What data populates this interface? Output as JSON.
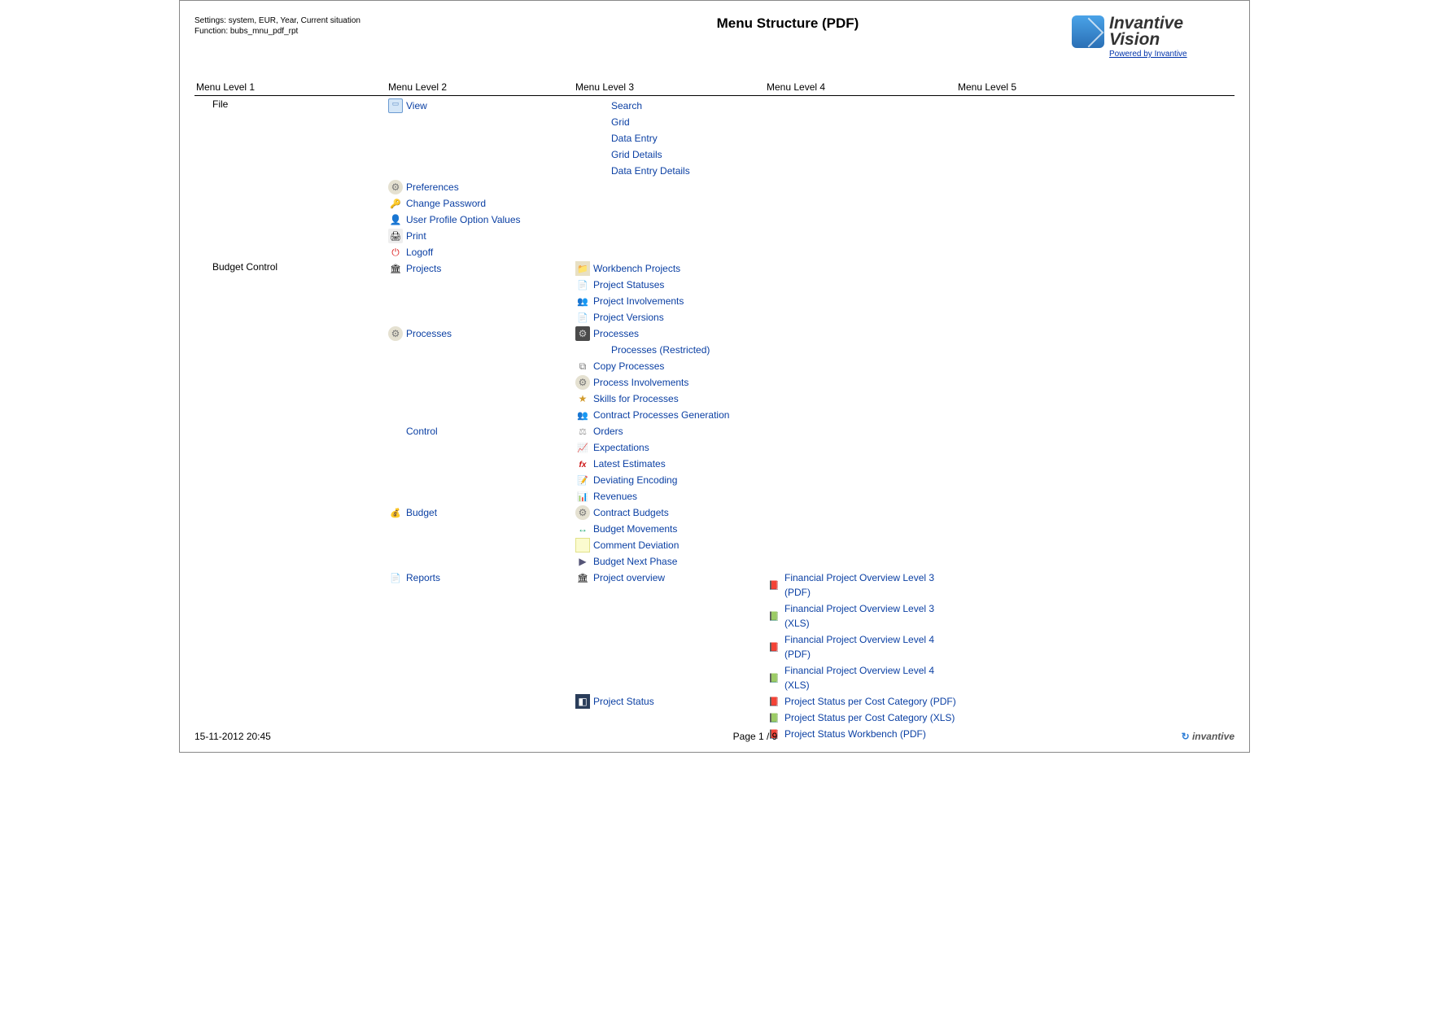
{
  "settings_line": "Settings: system, EUR, Year, Current situation",
  "function_line": "Function: bubs_mnu_pdf_rpt",
  "title": "Menu Structure (PDF)",
  "logo": {
    "line1": "Invantive",
    "line2": "Vision",
    "powered": "Powered by Invantive"
  },
  "columns": [
    "Menu Level 1",
    "Menu Level 2",
    "Menu Level 3",
    "Menu Level 4",
    "Menu Level 5"
  ],
  "tree": [
    {
      "l1": "File",
      "l2": [
        {
          "label": "View",
          "icon": "icon-monitor",
          "l3": [
            {
              "label": "Search"
            },
            {
              "label": "Grid"
            },
            {
              "label": "Data Entry"
            },
            {
              "label": "Grid Details"
            },
            {
              "label": "Data Entry Details"
            }
          ]
        },
        {
          "label": "Preferences",
          "icon": "icon-gear"
        },
        {
          "label": "Change Password",
          "icon": "icon-key"
        },
        {
          "label": "User Profile Option Values",
          "icon": "icon-user"
        },
        {
          "label": "Print",
          "icon": "icon-printer"
        },
        {
          "label": "Logoff",
          "icon": "icon-logoff"
        }
      ]
    },
    {
      "l1": "Budget Control",
      "l2": [
        {
          "label": "Projects",
          "icon": "icon-over",
          "l3": [
            {
              "label": "Workbench Projects",
              "icon": "icon-folder"
            },
            {
              "label": "Project Statuses",
              "icon": "icon-doc"
            },
            {
              "label": "Project Involvements",
              "icon": "icon-people"
            },
            {
              "label": "Project Versions",
              "icon": "icon-doc"
            }
          ]
        },
        {
          "label": "Processes",
          "icon": "icon-gear",
          "l3": [
            {
              "label": "Processes",
              "icon": "icon-cog"
            },
            {
              "label": "Processes (Restricted)"
            },
            {
              "label": "Copy Processes",
              "icon": "icon-copy"
            },
            {
              "label": "Process Involvements",
              "icon": "icon-gear"
            },
            {
              "label": "Skills for Processes",
              "icon": "icon-skill"
            },
            {
              "label": "Contract Processes Generation",
              "icon": "icon-people"
            }
          ]
        },
        {
          "label": "Control",
          "l3": [
            {
              "label": "Orders",
              "icon": "icon-scale"
            },
            {
              "label": "Expectations",
              "icon": "icon-chart"
            },
            {
              "label": "Latest Estimates",
              "icon": "icon-fx"
            },
            {
              "label": "Deviating Encoding",
              "icon": "icon-note"
            },
            {
              "label": "Revenues",
              "icon": "icon-rev"
            }
          ]
        },
        {
          "label": "Budget",
          "icon": "icon-budget",
          "l3": [
            {
              "label": "Contract Budgets",
              "icon": "icon-gear"
            },
            {
              "label": "Budget Movements",
              "icon": "icon-move"
            },
            {
              "label": "Comment Deviation",
              "icon": "icon-comment"
            },
            {
              "label": "Budget Next Phase",
              "icon": "icon-phase"
            }
          ]
        },
        {
          "label": "Reports",
          "icon": "icon-report",
          "l3": [
            {
              "label": "Project overview",
              "icon": "icon-over",
              "l4": [
                {
                  "label": "Financial Project Overview Level 3 (PDF)",
                  "icon": "icon-pdf"
                },
                {
                  "label": "Financial Project Overview Level 3 (XLS)",
                  "icon": "icon-xls"
                },
                {
                  "label": "Financial Project Overview Level 4 (PDF)",
                  "icon": "icon-pdf"
                },
                {
                  "label": "Financial Project Overview Level 4 (XLS)",
                  "icon": "icon-xls"
                }
              ]
            },
            {
              "label": "Project Status",
              "icon": "icon-status",
              "l4": [
                {
                  "label": "Project Status per Cost Category (PDF)",
                  "icon": "icon-pdf"
                },
                {
                  "label": "Project Status per Cost Category (XLS)",
                  "icon": "icon-xls"
                },
                {
                  "label": "Project Status Workbench (PDF)",
                  "icon": "icon-pdf"
                }
              ]
            }
          ]
        }
      ]
    }
  ],
  "footer": {
    "timestamp": "15-11-2012 20:45",
    "page": "Page 1 / 9",
    "brand": "invantive"
  }
}
